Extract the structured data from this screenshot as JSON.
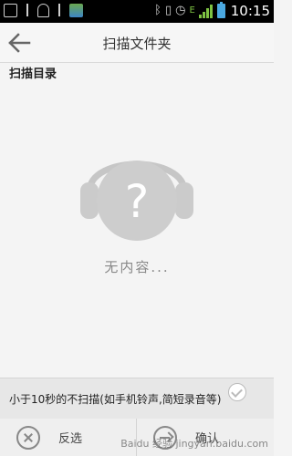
{
  "status_bar": {
    "time": "10:15",
    "network": "E"
  },
  "header": {
    "title": "扫描文件夹"
  },
  "section": {
    "title": "扫描目录"
  },
  "empty_state": {
    "text": "无内容..."
  },
  "footer": {
    "note": "小于10秒的不扫描(如手机铃声,简短录音等)"
  },
  "bottom_bar": {
    "invert_label": "反选",
    "confirm_label": "确认"
  },
  "watermark": "Baidu 经验 jingyan.baidu.com"
}
